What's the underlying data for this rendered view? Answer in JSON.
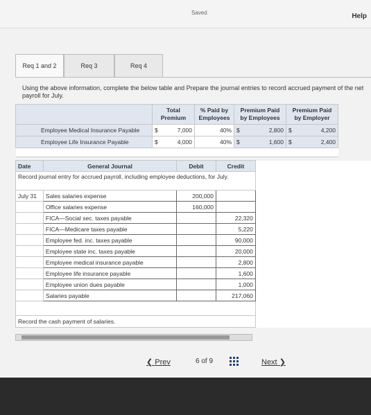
{
  "topbar": {
    "saved_label": "Saved",
    "help_label": "Help"
  },
  "tabs": [
    {
      "label": "Req 1 and 2"
    },
    {
      "label": "Req 3"
    },
    {
      "label": "Req 4"
    }
  ],
  "instructions": "Using the above information, complete the below table and Prepare the journal entries to record accrued payment of the net payroll for July.",
  "premium_table": {
    "headers": [
      "",
      "Total Premium",
      "% Paid by Employees",
      "Premium Paid by Employees",
      "Premium Paid by Employer"
    ],
    "rows": [
      {
        "label": "Employee Medical Insurance Payable",
        "currency1": "$",
        "total": "7,000",
        "pct": "40%",
        "currency2": "$",
        "paid_emp": "2,800",
        "currency3": "$",
        "paid_employer": "4,200"
      },
      {
        "label": "Employee Life Insurance Payable",
        "currency1": "$",
        "total": "4,000",
        "pct": "40%",
        "currency2": "$",
        "paid_emp": "1,600",
        "currency3": "$",
        "paid_employer": "2,400"
      }
    ]
  },
  "journal": {
    "headers": {
      "date": "Date",
      "general": "General Journal",
      "debit": "Debit",
      "credit": "Credit"
    },
    "instruction1": "Record journal entry for accrued payroll, including employee deductions, for July.",
    "date": "July 31",
    "entries": [
      {
        "account": "Sales salaries expense",
        "debit": "200,000",
        "credit": ""
      },
      {
        "account": "Office salaries expense",
        "debit": "160,000",
        "credit": ""
      },
      {
        "account": "FICA—Social sec. taxes payable",
        "debit": "",
        "credit": "22,320"
      },
      {
        "account": "FICA—Medicare taxes payable",
        "debit": "",
        "credit": "5,220"
      },
      {
        "account": "Employee fed. inc. taxes payable",
        "debit": "",
        "credit": "90,000"
      },
      {
        "account": "Employee state inc. taxes payable",
        "debit": "",
        "credit": "20,000"
      },
      {
        "account": "Employee medical insurance payable",
        "debit": "",
        "credit": "2,800"
      },
      {
        "account": "Employee life insurance payable",
        "debit": "",
        "credit": "1,600"
      },
      {
        "account": "Employee union dues payable",
        "debit": "",
        "credit": "1,000"
      },
      {
        "account": "Salaries payable",
        "debit": "",
        "credit": "217,060"
      }
    ],
    "instruction2": "Record the cash payment of salaries."
  },
  "nav": {
    "prev": "Prev",
    "page": "6",
    "of": "of",
    "total": "9",
    "next": "Next"
  }
}
